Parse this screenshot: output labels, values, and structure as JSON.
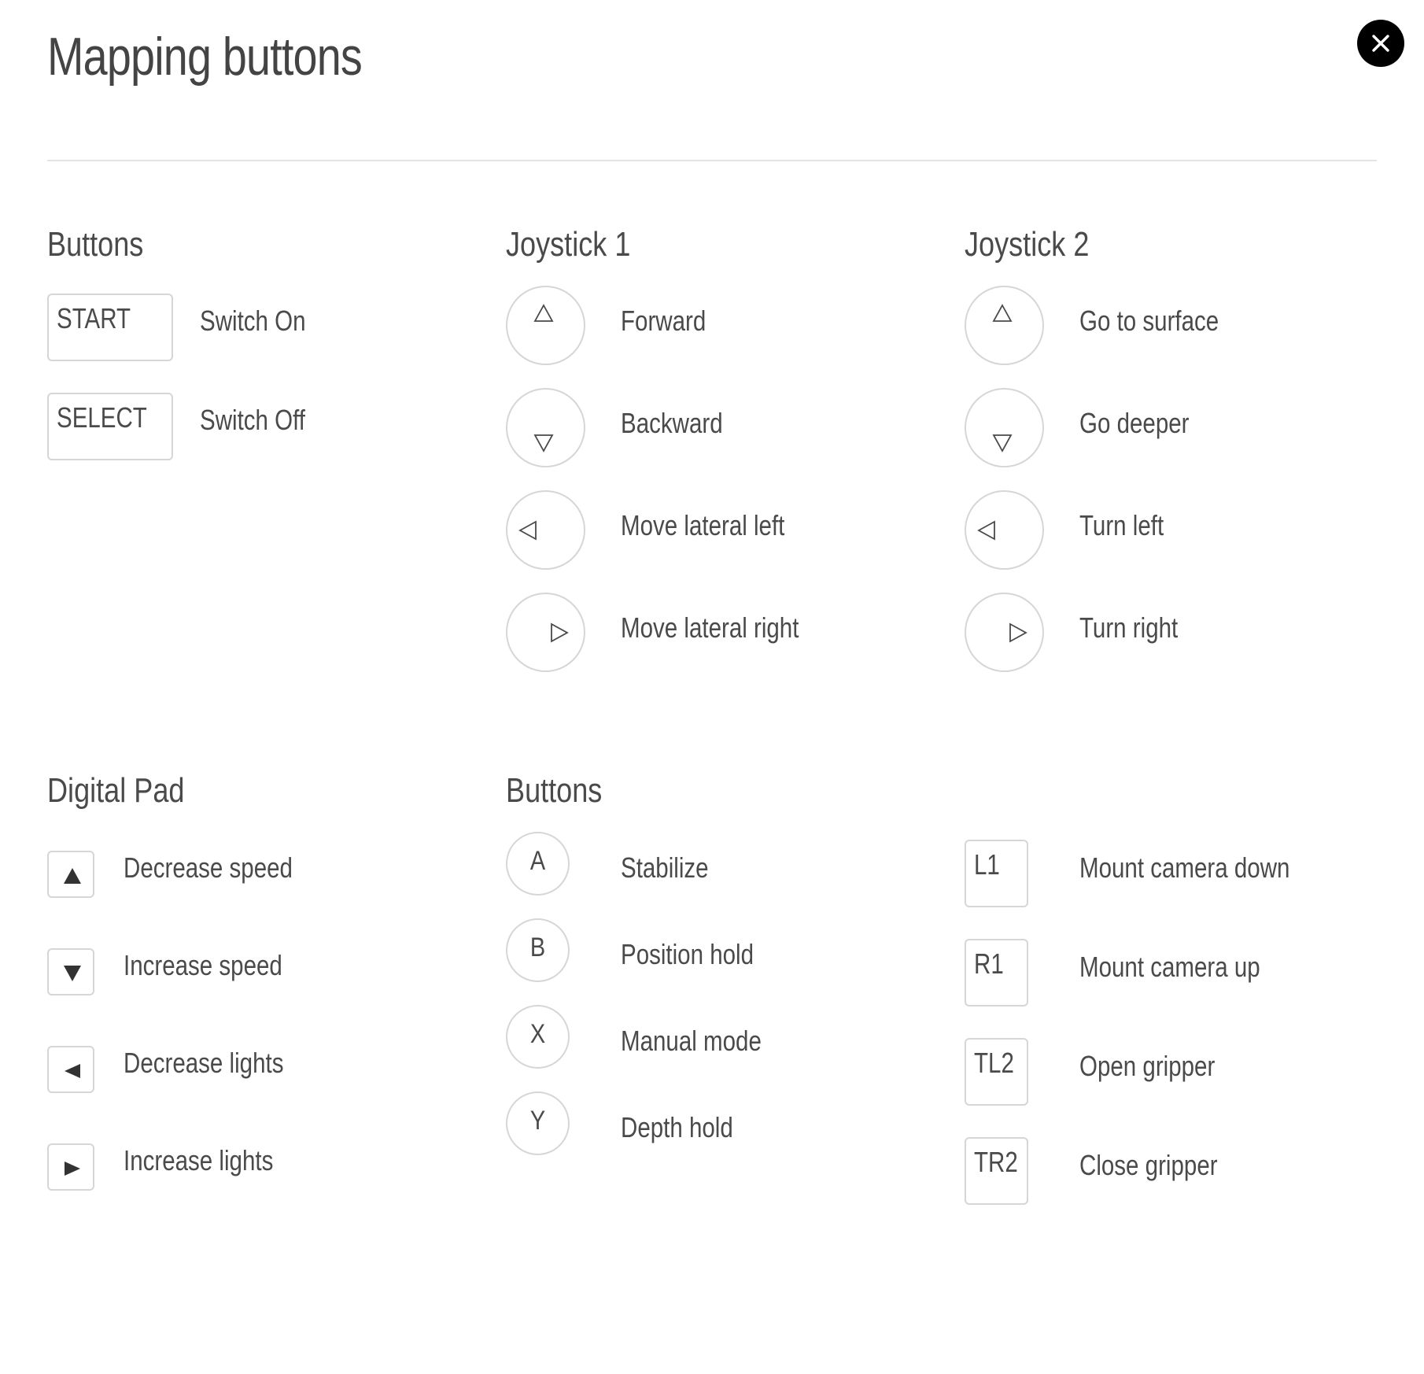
{
  "dialog": {
    "title": "Mapping buttons"
  },
  "close_icon": "close-icon",
  "sections": {
    "buttons_top": {
      "title": "Buttons",
      "items": [
        {
          "key": "START",
          "action": "Switch On"
        },
        {
          "key": "SELECT",
          "action": "Switch Off"
        }
      ]
    },
    "joystick1": {
      "title": "Joystick 1",
      "items": [
        {
          "icon": "triangle-up-outline-icon",
          "action": "Forward"
        },
        {
          "icon": "triangle-down-outline-icon",
          "action": "Backward"
        },
        {
          "icon": "triangle-left-outline-icon",
          "action": "Move lateral left"
        },
        {
          "icon": "triangle-right-outline-icon",
          "action": "Move lateral right"
        }
      ]
    },
    "joystick2": {
      "title": "Joystick 2",
      "items": [
        {
          "icon": "triangle-up-outline-icon",
          "action": "Go to surface"
        },
        {
          "icon": "triangle-down-outline-icon",
          "action": "Go deeper"
        },
        {
          "icon": "triangle-left-outline-icon",
          "action": "Turn left"
        },
        {
          "icon": "triangle-right-outline-icon",
          "action": "Turn right"
        }
      ]
    },
    "digital_pad": {
      "title": "Digital Pad",
      "items": [
        {
          "icon": "arrow-up-solid-icon",
          "action": "Decrease speed"
        },
        {
          "icon": "arrow-down-solid-icon",
          "action": "Increase speed"
        },
        {
          "icon": "arrow-left-solid-icon",
          "action": "Decrease lights"
        },
        {
          "icon": "arrow-right-solid-icon",
          "action": "Increase lights"
        }
      ]
    },
    "buttons_face": {
      "title": "Buttons",
      "items": [
        {
          "key": "A",
          "action": "Stabilize"
        },
        {
          "key": "B",
          "action": "Position hold"
        },
        {
          "key": "X",
          "action": "Manual mode"
        },
        {
          "key": "Y",
          "action": "Depth hold"
        }
      ]
    },
    "buttons_shoulder": {
      "items": [
        {
          "key": "L1",
          "action": "Mount camera down"
        },
        {
          "key": "R1",
          "action": "Mount camera up"
        },
        {
          "key": "TL2",
          "action": "Open gripper"
        },
        {
          "key": "TR2",
          "action": "Close gripper"
        }
      ]
    }
  },
  "colors": {
    "text": "#4a4a4a",
    "border": "#d6d6d6",
    "close_bg": "#000000",
    "close_fg": "#ffffff"
  }
}
